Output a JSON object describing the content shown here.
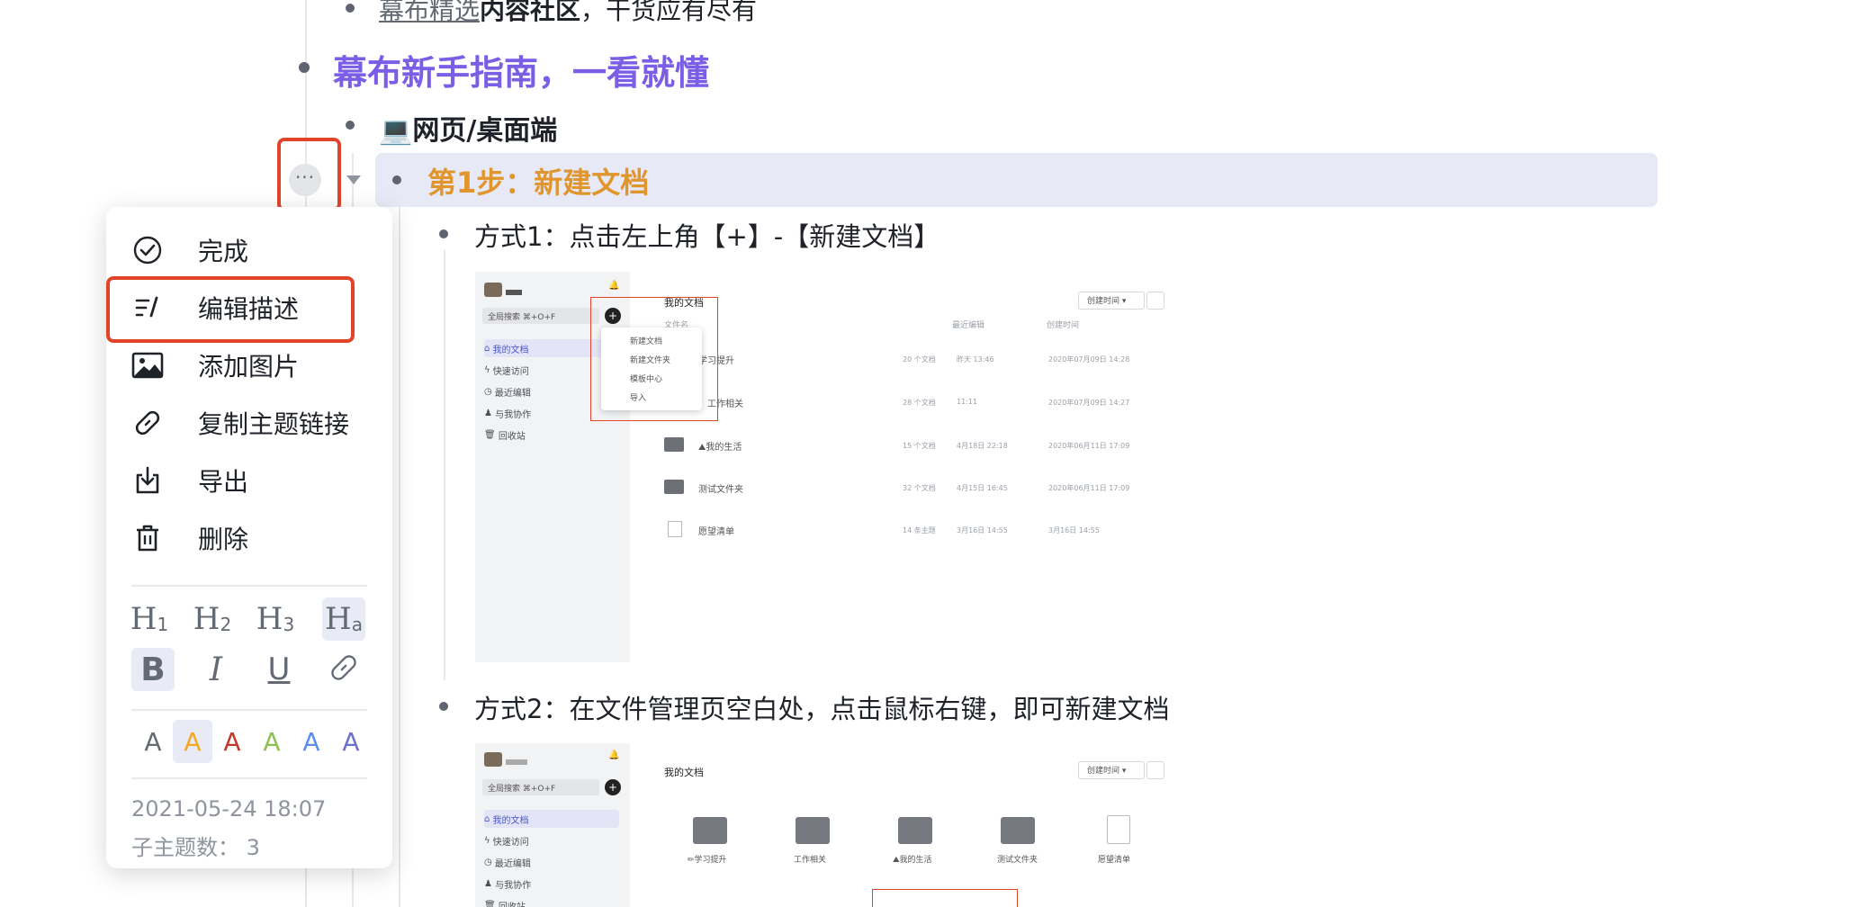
{
  "outline": {
    "prev_item": {
      "link": "幕布精选",
      "bold": "内容社区",
      "rest": "，干货应有尽有"
    },
    "heading": "幕布新手指南，一看就懂",
    "platform_item": "💻网页/桌面端",
    "step1": "第1步：新建文档",
    "method1": "方式1：点击左上角【+】-【新建文档】",
    "method2": "方式2：在文件管理页空白处，点击鼠标右键，即可新建文档"
  },
  "menu": {
    "items": [
      {
        "label": "完成",
        "icon": "check-circle-icon"
      },
      {
        "label": "编辑描述",
        "icon": "edit-description-icon"
      },
      {
        "label": "添加图片",
        "icon": "image-icon"
      },
      {
        "label": "复制主题链接",
        "icon": "link-icon"
      },
      {
        "label": "导出",
        "icon": "export-icon"
      },
      {
        "label": "删除",
        "icon": "trash-icon"
      }
    ],
    "headings": [
      {
        "char": "H",
        "sub": "1"
      },
      {
        "char": "H",
        "sub": "2"
      },
      {
        "char": "H",
        "sub": "3"
      },
      {
        "char": "H",
        "sub": "a"
      }
    ],
    "format": {
      "bold": "B",
      "italic": "I",
      "underline": "U"
    },
    "colors": [
      {
        "letter": "A",
        "color": "#646a73"
      },
      {
        "letter": "A",
        "color": "#f5a623"
      },
      {
        "letter": "A",
        "color": "#c0392b"
      },
      {
        "letter": "A",
        "color": "#8cc152"
      },
      {
        "letter": "A",
        "color": "#5b8def"
      },
      {
        "letter": "A",
        "color": "#6a6fc9"
      }
    ],
    "date": "2021-05-24 18:07",
    "subtopics": "子主题数：  3"
  },
  "shot1": {
    "search": "全局搜索 ⌘+O+F",
    "sidebar": [
      "我的文档",
      "快速访问",
      "最近编辑",
      "与我协作",
      "回收站"
    ],
    "title": "我的文档",
    "sort": "创建时间 ▾",
    "headers": [
      "文件名",
      "最近编辑",
      "创建时间"
    ],
    "popup": [
      "新建文档",
      "新建文件夹",
      "模板中心",
      "导入"
    ],
    "rows": [
      {
        "name": "学习提升",
        "count": "20 个文档",
        "edited": "昨天 13:46",
        "created": "2020年07月09日 14:28"
      },
      {
        "name": "工作相关",
        "count": "28 个文档",
        "edited": "11:11",
        "created": "2020年07月09日 14:27"
      },
      {
        "name": "⛰我的生活",
        "count": "15 个文档",
        "edited": "4月18日 22:18",
        "created": "2020年06月11日 17:09"
      },
      {
        "name": "测试文件夹",
        "count": "32 个文档",
        "edited": "4月15日 16:45",
        "created": "2020年06月11日 17:09"
      },
      {
        "name": "愿望清单",
        "count": "14 条主题",
        "edited": "3月16日 14:55",
        "created": "3月16日 14:55"
      }
    ]
  },
  "shot2": {
    "search": "全局搜索 ⌘+O+F",
    "sidebar": [
      "我的文档",
      "快速访问",
      "最近编辑",
      "与我协作",
      "回收站"
    ],
    "title": "我的文档",
    "sort": "创建时间 ▾",
    "folders": [
      "✏学习提升",
      "工作相关",
      "⛰我的生活",
      "测试文件夹",
      "愿望清单"
    ]
  }
}
